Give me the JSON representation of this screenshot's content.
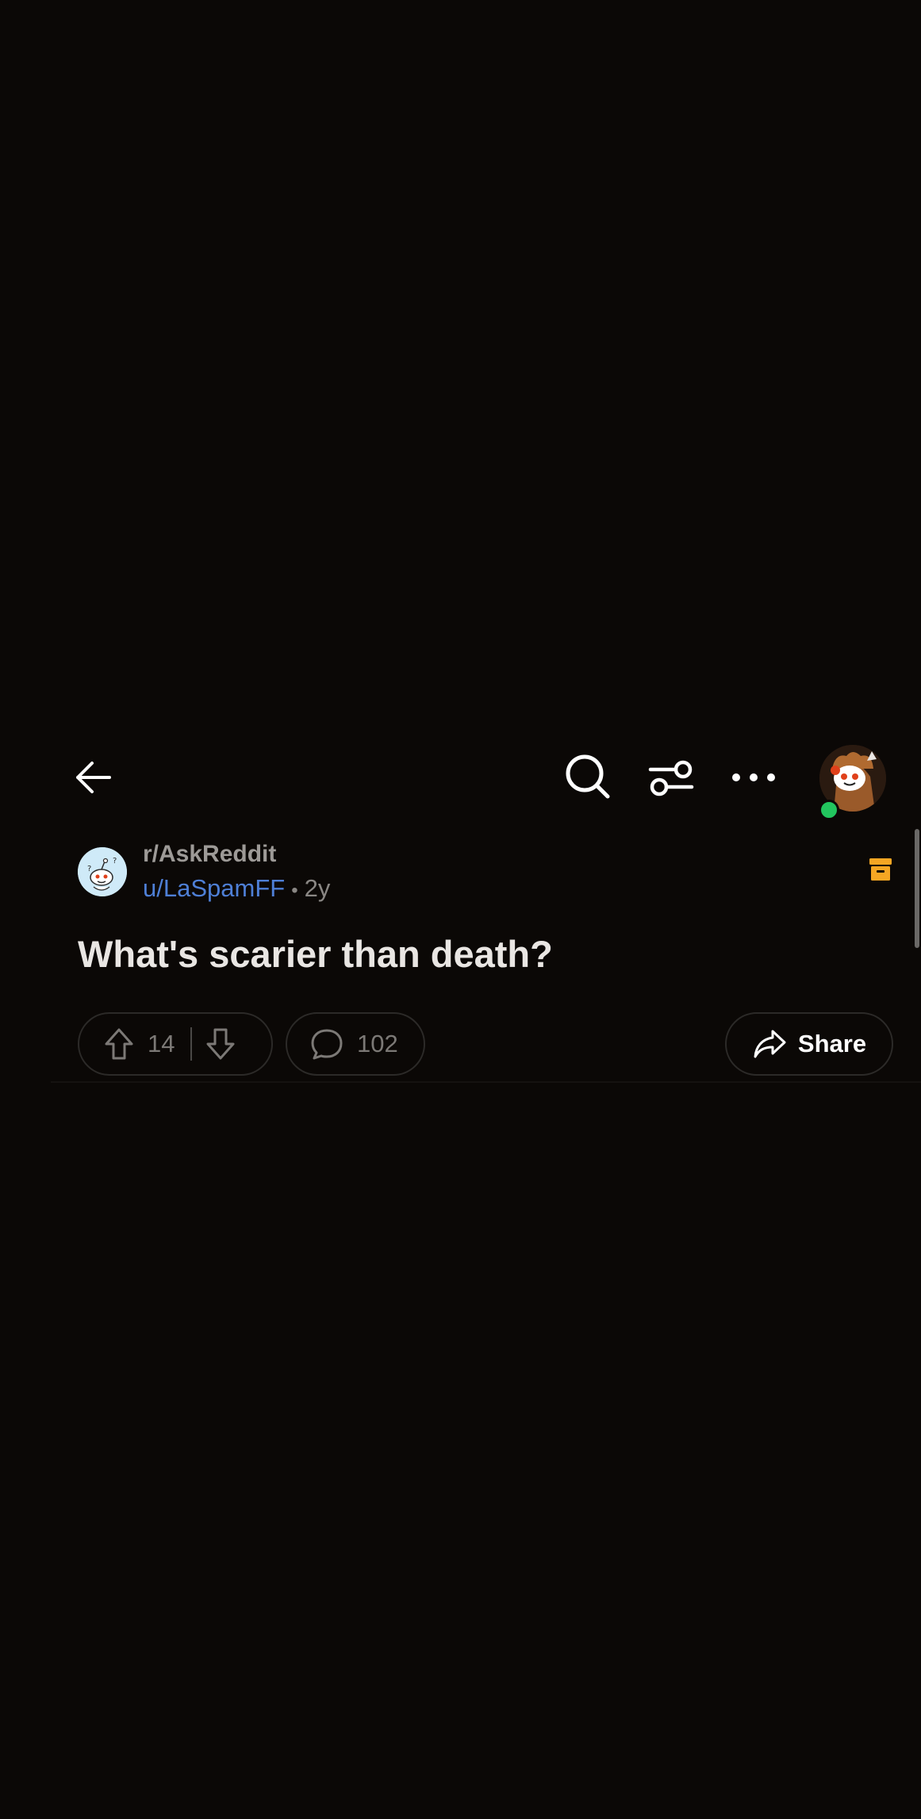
{
  "theme": {
    "background": "#0b0806",
    "username_color": "#4e7fd6",
    "archive_color": "#f5a623",
    "online_color": "#22c55e"
  },
  "topbar": {
    "back_icon": "arrow-left-icon",
    "search_icon": "search-icon",
    "filter_icon": "sort-toggle-icon",
    "more_icon": "more-horizontal-icon",
    "avatar_icon": "user-avatar-snoo-icon"
  },
  "post": {
    "subreddit": "r/AskReddit",
    "author": "u/LaSpamFF",
    "separator": "•",
    "age": "2y",
    "title": "What's scarier than death?",
    "archived_icon": "archive-icon"
  },
  "actions": {
    "upvotes": "14",
    "comments": "102",
    "share_label": "Share"
  }
}
